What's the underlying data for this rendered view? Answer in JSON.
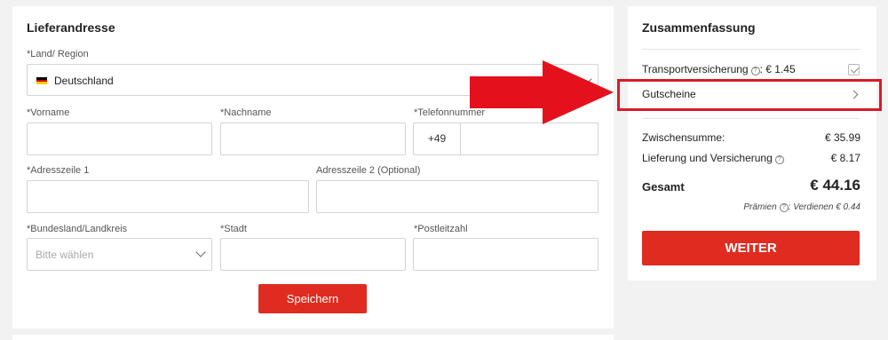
{
  "address": {
    "title": "Lieferandresse",
    "country_label": "*Land/ Region",
    "country_value": "Deutschland",
    "firstname_label": "*Vorname",
    "lastname_label": "*Nachname",
    "phone_label": "*Telefonnummer",
    "phone_prefix": "+49",
    "address1_label": "*Adresszeile 1",
    "address2_label": "Adresszeile 2 (Optional)",
    "state_label": "*Bundesland/Landkreis",
    "state_placeholder": "Bitte wählen",
    "city_label": "*Stadt",
    "zip_label": "*Postleitzahl",
    "save_label": "Speichern"
  },
  "summary": {
    "title": "Zusammenfassung",
    "insurance_label": "Transportversicherung",
    "insurance_value": ": € 1.45",
    "insurance_checked": true,
    "coupons_label": "Gutscheine",
    "subtotal_label": "Zwischensumme:",
    "subtotal_value": "€ 35.99",
    "shipping_label": "Lieferung und Versicherung",
    "shipping_value": "€ 8.17",
    "total_label": "Gesamt",
    "total_value": "€ 44.16",
    "rewards_label": "Prämien",
    "rewards_value": ": Verdienen € 0.44",
    "continue_label": "WEITER"
  },
  "icons": {
    "help": "?",
    "flag": "germany-flag-icon"
  },
  "colors": {
    "accent": "#e02b20",
    "annotation": "#d81b27"
  }
}
